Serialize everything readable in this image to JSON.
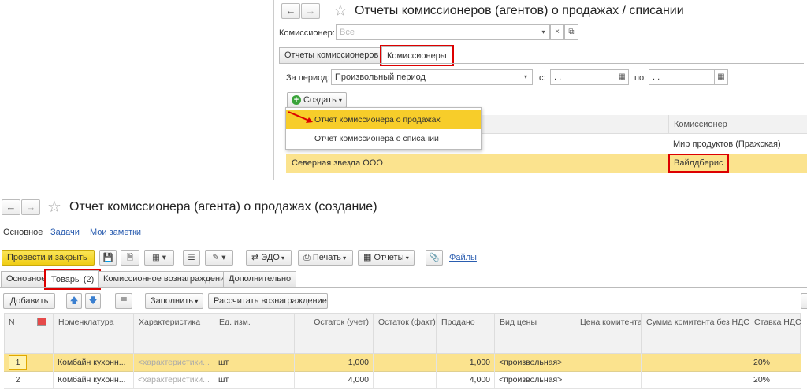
{
  "top": {
    "title": "Отчеты комиссионеров (агентов) о продажах / списании",
    "commissioner_label": "Комиссионер:",
    "commissioner_placeholder": "Все",
    "tabs": [
      "Отчеты комиссионеров",
      "Комиссионеры"
    ],
    "period_label": "За период:",
    "period_value": "Произвольный период",
    "from_label": "с:",
    "from_value": ". .",
    "to_label": "по:",
    "to_value": ". .",
    "create_button": "Создать",
    "menu_items": [
      "Отчет комиссионера о продажах",
      "Отчет комиссионера о списании"
    ],
    "column_header": "Комиссионер",
    "rows": [
      {
        "name": "",
        "commissioner": "Мир продуктов (Пражская)"
      },
      {
        "name": "Северная звезда ООО",
        "commissioner": "Вайлдберис"
      }
    ]
  },
  "bottom": {
    "title": "Отчет комиссионера (агента) о продажах (создание)",
    "nav": [
      "Основное",
      "Задачи",
      "Мои заметки"
    ],
    "post_close": "Провести и закрыть",
    "edo": "ЭДО",
    "print": "Печать",
    "reports": "Отчеты",
    "files": "Файлы",
    "tabs": [
      "Основное",
      "Товары (2)",
      "Комиссионное вознаграждение",
      "Дополнительно"
    ],
    "add": "Добавить",
    "fill": "Заполнить",
    "calc": "Рассчитать вознаграждение",
    "headers": [
      "N",
      "",
      "Номенклатура",
      "Характеристика",
      "Ед. изм.",
      "Остаток (учет)",
      "Остаток (факт)",
      "Продано",
      "Вид цены",
      "Цена комитента",
      "Сумма комитента без НДС",
      "Ставка НДС"
    ],
    "rows": [
      {
        "n": "1",
        "nom": "Комбайн кухонн...",
        "char": "<характеристики...",
        "unit": "шт",
        "acc": "1,000",
        "fact": "",
        "sold": "1,000",
        "price_type": "<произвольная>",
        "price": "",
        "sum": "",
        "vat": "20%"
      },
      {
        "n": "2",
        "nom": "Комбайн кухонн...",
        "char": "<характеристики...",
        "unit": "шт",
        "acc": "4,000",
        "fact": "",
        "sold": "4,000",
        "price_type": "<произвольная>",
        "price": "",
        "sum": "",
        "vat": "20%"
      }
    ]
  },
  "colors": {
    "accent_yellow": "#fbe38e",
    "selection": "#f7cd2a",
    "highlight_red": "#dd0000",
    "link": "#2a5db0"
  },
  "icons": [
    "back-arrow-icon",
    "forward-arrow-icon",
    "star-icon",
    "dropdown-icon",
    "clear-icon",
    "open-icon",
    "calendar-icon",
    "plus-circle-icon",
    "red-arrow-icon",
    "save-icon",
    "document-icon",
    "printer-icon",
    "paperclip-icon",
    "arrow-up-icon",
    "arrow-down-icon",
    "barcode-icon"
  ]
}
